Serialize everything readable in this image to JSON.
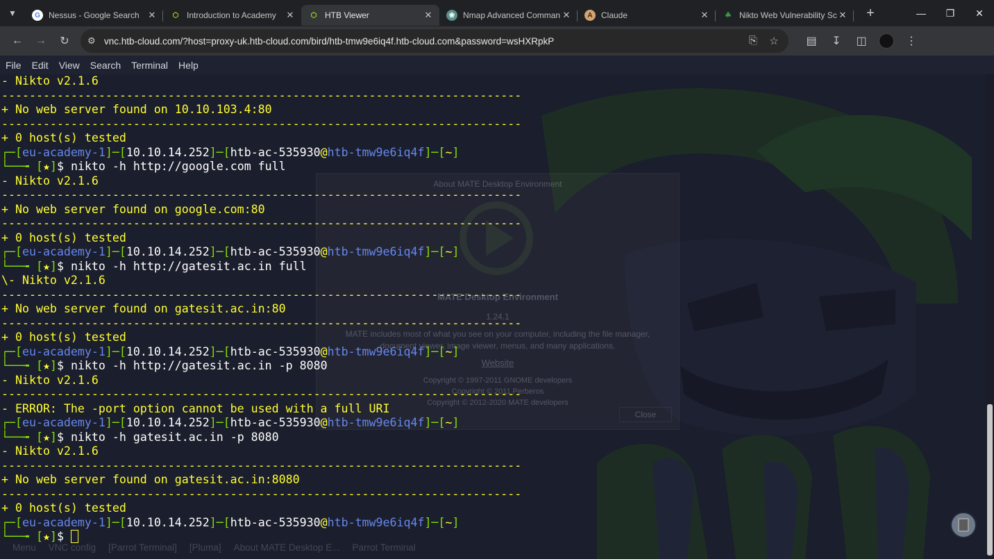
{
  "tabs": [
    {
      "title": "Nessus - Google Search",
      "favicon": "google-icon",
      "active": false
    },
    {
      "title": "Introduction to Academy",
      "favicon": "htb-cube-icon",
      "active": false
    },
    {
      "title": "HTB Viewer",
      "favicon": "htb-cube-icon",
      "active": true
    },
    {
      "title": "Nmap Advanced Comman",
      "favicon": "chatgpt-icon",
      "active": false
    },
    {
      "title": "Claude",
      "favicon": "claude-icon",
      "active": false
    },
    {
      "title": "Nikto Web Vulnerability Sc",
      "favicon": "nikto-icon",
      "active": false
    }
  ],
  "address_bar": {
    "url": "vnc.htb-cloud.com/?host=proxy-uk.htb-cloud.com/bird/htb-tmw9e6iq4f.htb-cloud.com&password=wsHXRpkP"
  },
  "terminal": {
    "menu": [
      "File",
      "Edit",
      "View",
      "Search",
      "Terminal",
      "Help"
    ],
    "prompt": {
      "host_group": "eu-academy-1",
      "ip": "10.10.14.252",
      "user": "htb-ac-535930",
      "machine": "htb-tmw9e6iq4f",
      "dir": "~",
      "star": "★"
    },
    "separator": "---------------------------------------------------------------------------",
    "lines": [
      {
        "kind": "out",
        "text": "- Nikto v2.1.6"
      },
      {
        "kind": "sep"
      },
      {
        "kind": "out",
        "text": "+ No web server found on 10.10.103.4:80"
      },
      {
        "kind": "sep"
      },
      {
        "kind": "out",
        "text": "+ 0 host(s) tested"
      },
      {
        "kind": "prompt"
      },
      {
        "kind": "cmd",
        "text": "nikto -h http://google.com full"
      },
      {
        "kind": "out",
        "text": "- Nikto v2.1.6"
      },
      {
        "kind": "sep"
      },
      {
        "kind": "out",
        "text": "+ No web server found on google.com:80"
      },
      {
        "kind": "sep"
      },
      {
        "kind": "out",
        "text": "+ 0 host(s) tested"
      },
      {
        "kind": "prompt"
      },
      {
        "kind": "cmd",
        "text": "nikto -h http://gatesit.ac.in full"
      },
      {
        "kind": "out",
        "text": "\\- Nikto v2.1.6"
      },
      {
        "kind": "sep"
      },
      {
        "kind": "out",
        "text": "+ No web server found on gatesit.ac.in:80"
      },
      {
        "kind": "sep"
      },
      {
        "kind": "out",
        "text": "+ 0 host(s) tested"
      },
      {
        "kind": "prompt"
      },
      {
        "kind": "cmd",
        "text": "nikto -h http://gatesit.ac.in -p 8080"
      },
      {
        "kind": "out",
        "text": "- Nikto v2.1.6"
      },
      {
        "kind": "sep"
      },
      {
        "kind": "out",
        "text": "- ERROR: The -port option cannot be used with a full URI"
      },
      {
        "kind": "prompt"
      },
      {
        "kind": "cmd",
        "text": "nikto -h gatesit.ac.in -p 8080"
      },
      {
        "kind": "out",
        "text": "- Nikto v2.1.6"
      },
      {
        "kind": "sep"
      },
      {
        "kind": "out",
        "text": "+ No web server found on gatesit.ac.in:8080"
      },
      {
        "kind": "sep"
      },
      {
        "kind": "out",
        "text": "+ 0 host(s) tested"
      },
      {
        "kind": "prompt"
      },
      {
        "kind": "input",
        "text": ""
      }
    ]
  },
  "background_dialog": {
    "title": "About MATE Desktop Environment",
    "name": "MATE Desktop Environment",
    "version": "1.24.1",
    "description": "MATE includes most of what you see on your computer, including the file manager, document viewer, image viewer, menus, and many applications.",
    "link": "Website",
    "copyright": [
      "Copyright © 1997-2011 GNOME developers",
      "Copyright © 2011 Perberos",
      "Copyright © 2012-2020 MATE developers"
    ],
    "close_label": "Close"
  },
  "background_taskbar": [
    "Menu",
    "VNC config",
    "[Parrot Terminal]",
    "[Pluma]",
    "About MATE Desktop E...",
    "Parrot Terminal"
  ],
  "colors": {
    "terminal_bg": "#1b1e2c",
    "output_text": "#ffff33",
    "prompt_bracket": "#85e000",
    "prompt_host": "#6688ee"
  }
}
